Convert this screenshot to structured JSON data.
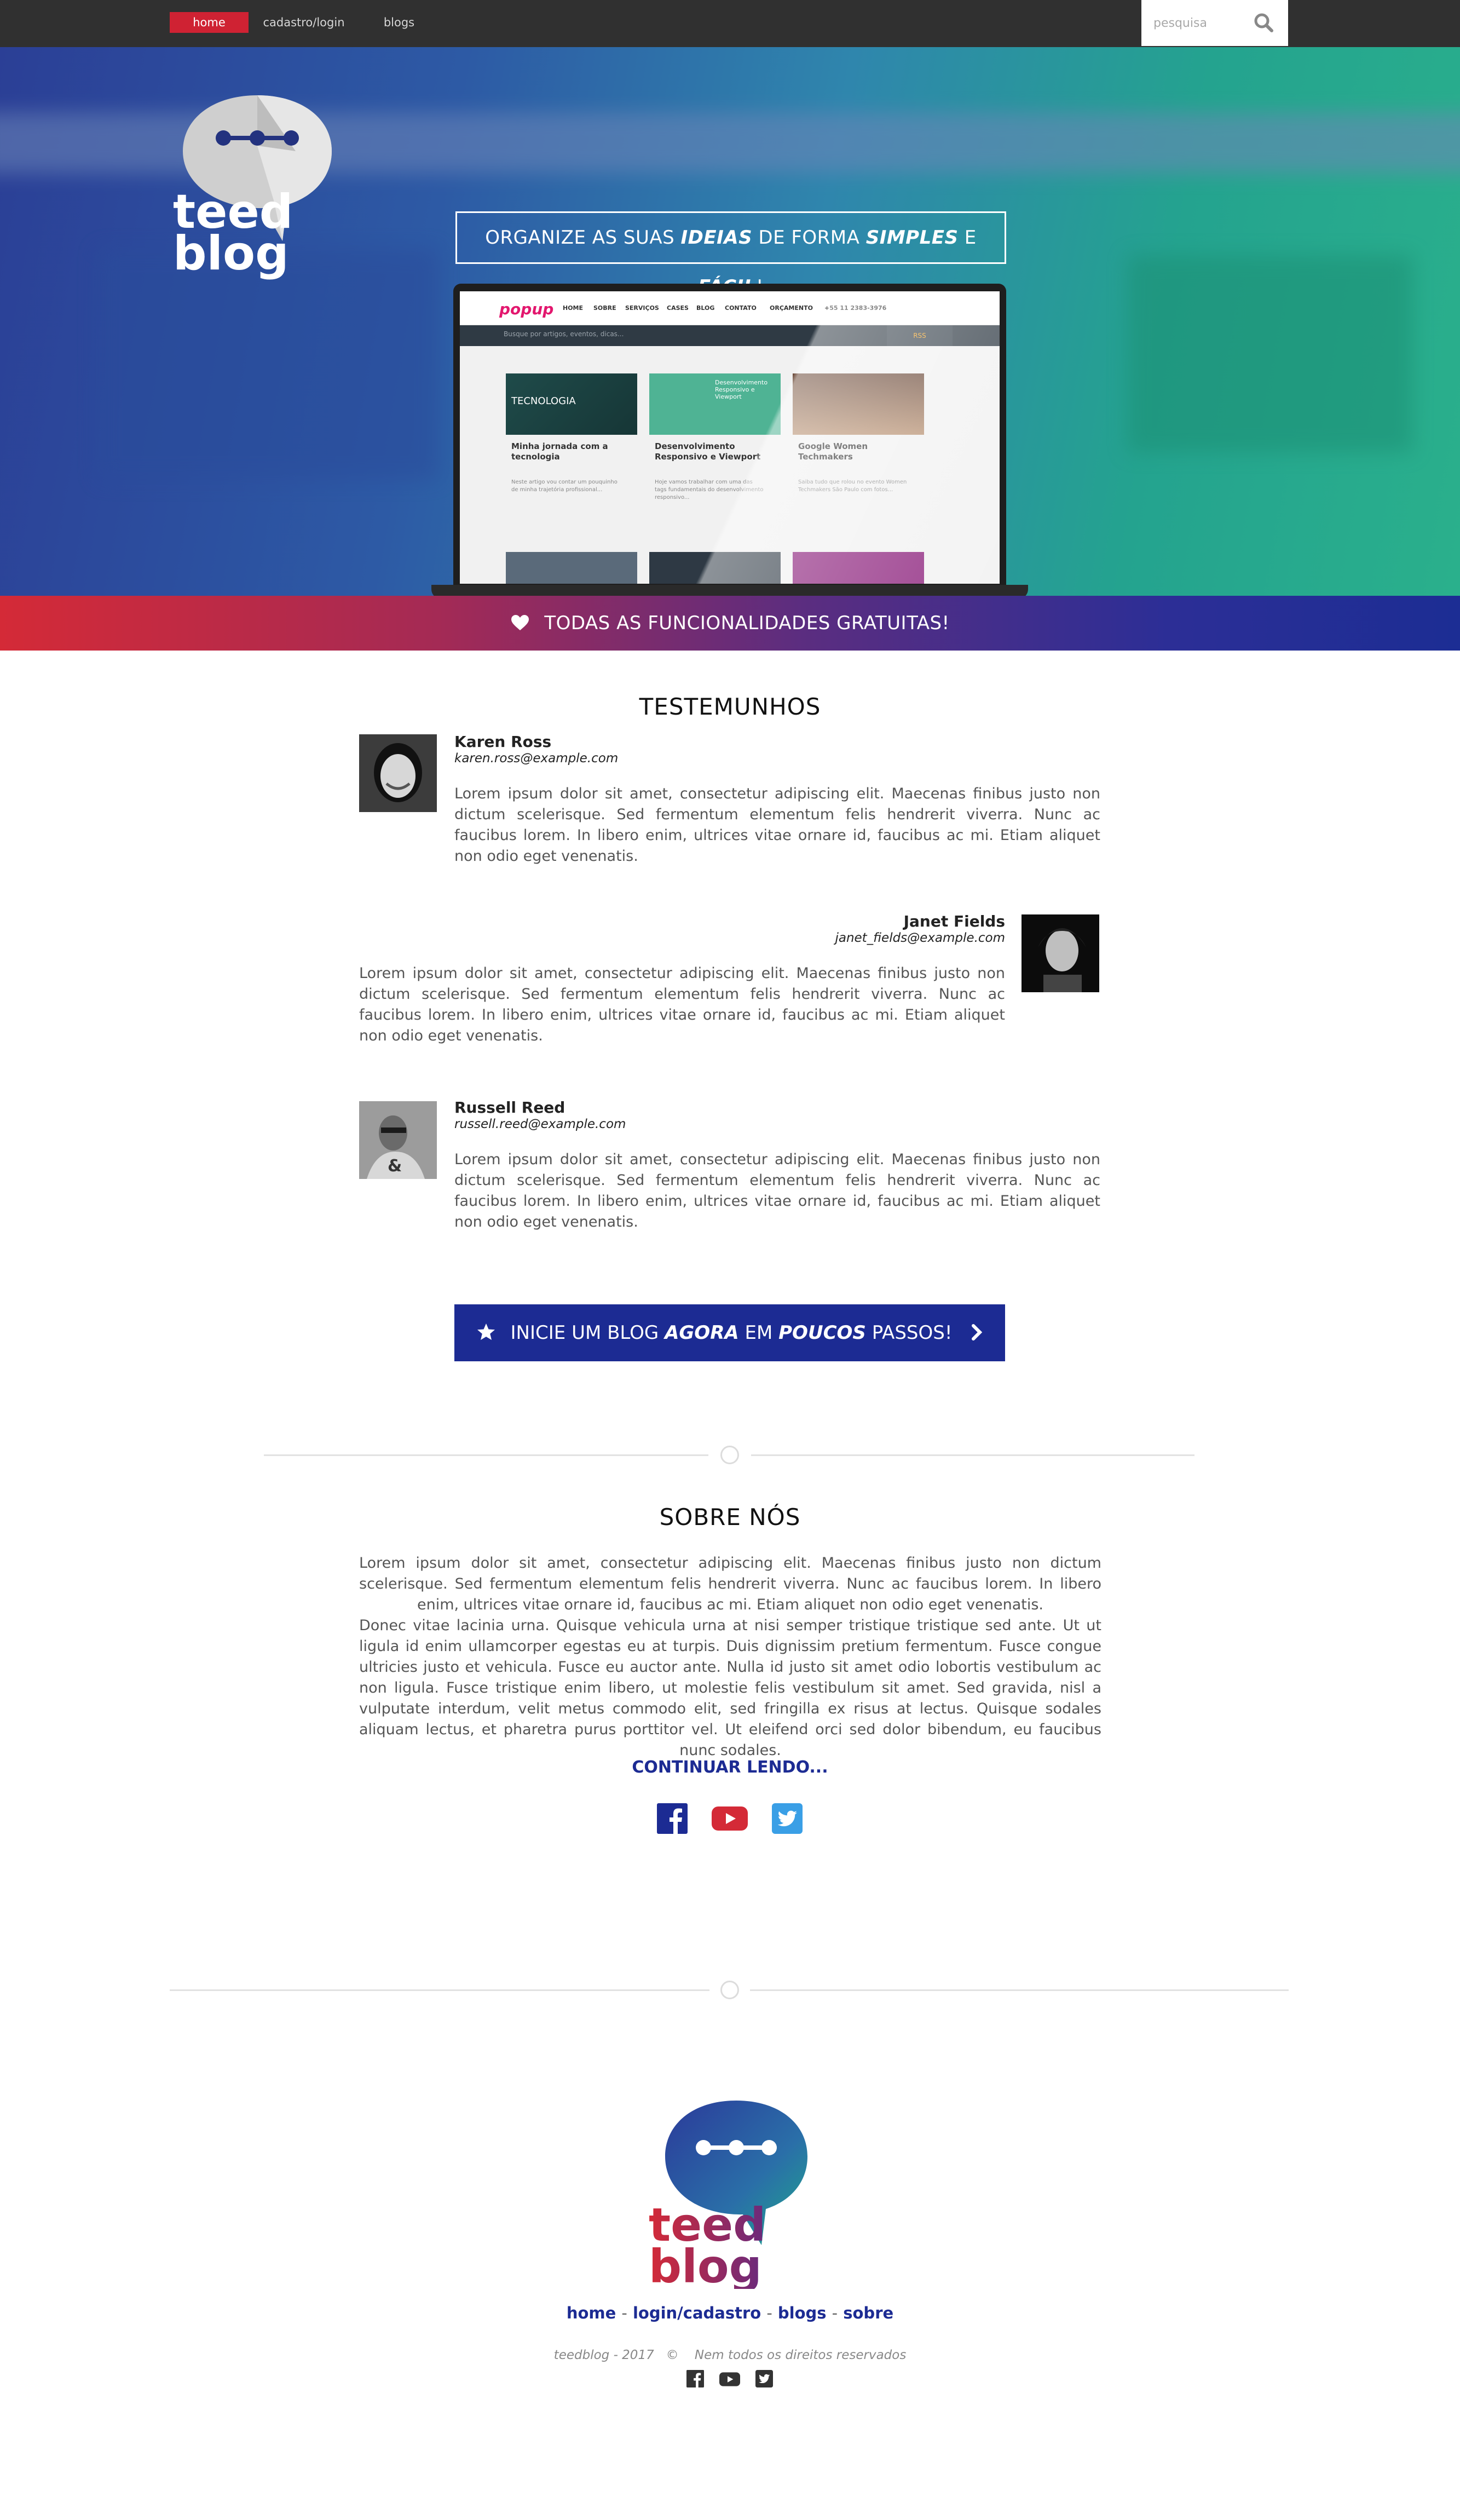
{
  "nav": {
    "items": [
      {
        "label": "home",
        "active": true
      },
      {
        "label": "cadastro/login",
        "active": false
      },
      {
        "label": "blogs",
        "active": false
      }
    ],
    "search_placeholder": "pesquisa"
  },
  "brand": {
    "logo_line1": "teed",
    "logo_line2": "blog"
  },
  "hero": {
    "tagline_1": "ORGANIZE AS SUAS ",
    "tagline_2": "IDEIAS",
    "tagline_3": " DE FORMA ",
    "tagline_4": "SIMPLES",
    "tagline_5": " E ",
    "tagline_6": "FÁCIL",
    "tagline_7": "!",
    "mockup": {
      "logo": "popup",
      "menu": [
        "HOME",
        "SOBRE",
        "SERVIÇOS",
        "CASES",
        "BLOG",
        "CONTATO",
        "ORÇAMENTO",
        "+55 11 2383-3976"
      ],
      "search": "Busque por artigos, eventos, dicas...",
      "rss": "RSS",
      "cards": [
        {
          "img_text": "TECNOLOGIA",
          "title": "Minha jornada com a tecnologia",
          "text": "Neste artigo vou contar um pouquinho de minha trajetória profissional..."
        },
        {
          "img_text": "Desenvolvimento Responsivo e Viewport",
          "title": "Desenvolvimento Responsivo e Viewport",
          "text": "Hoje vamos trabalhar com uma das tags fundamentais do desenvolvimento responsivo..."
        },
        {
          "img_text": "",
          "title": "Google Women Techmakers",
          "text": "Saiba tudo que rolou no evento Women Techmakers São Paulo com fotos..."
        }
      ]
    }
  },
  "free_band": {
    "text": "TODAS AS FUNCIONALIDADES GRATUITAS!"
  },
  "testimonials": {
    "title": "TESTEMUNHOS",
    "items": [
      {
        "name": "Karen Ross",
        "email": "karen.ross@example.com",
        "text": "Lorem ipsum dolor sit amet, consectetur adipiscing elit. Maecenas finibus justo non dictum scelerisque. Sed fermentum elementum felis hendrerit viverra. Nunc ac faucibus lorem. In libero enim, ultrices vitae ornare id, faucibus ac mi. Etiam aliquet non odio eget venenatis."
      },
      {
        "name": "Janet Fields",
        "email": "janet_fields@example.com",
        "text": "Lorem ipsum dolor sit amet, consectetur adipiscing elit. Maecenas finibus justo non dictum scelerisque. Sed fermentum elementum felis hendrerit viverra. Nunc ac faucibus lorem. In libero enim, ultrices vitae ornare id, faucibus ac mi. Etiam aliquet non odio eget venenatis."
      },
      {
        "name": "Russell Reed",
        "email": "russell.reed@example.com",
        "text": "Lorem ipsum dolor sit amet, consectetur adipiscing elit. Maecenas finibus justo non dictum scelerisque. Sed fermentum elementum felis hendrerit viverra. Nunc ac faucibus lorem. In libero enim, ultrices vitae ornare id, faucibus ac mi. Etiam aliquet non odio eget venenatis."
      }
    ]
  },
  "cta": {
    "t1": "INICIE UM BLOG ",
    "t2": "AGORA",
    "t3": " EM ",
    "t4": "POUCOS",
    "t5": " PASSOS!"
  },
  "about": {
    "title": "SOBRE NÓS",
    "p1": "Lorem ipsum dolor sit amet, consectetur adipiscing elit. Maecenas finibus justo non dictum scelerisque. Sed fermentum elementum felis hendrerit viverra. Nunc ac faucibus lorem. In libero enim, ultrices vitae ornare id, faucibus ac mi. Etiam aliquet non odio eget venenatis.",
    "p2": "Donec vitae lacinia urna. Quisque vehicula urna at nisi semper tristique tristique sed ante. Ut ut ligula id enim ullamcorper egestas eu at turpis. Duis dignissim pretium fermentum. Fusce congue ultricies justo et vehicula. Fusce eu auctor ante. Nulla id justo sit amet odio lobortis vestibulum ac non ligula. Fusce tristique enim libero, ut molestie felis vestibulum sit amet. Sed gravida, nisl a vulputate interdum, velit metus commodo elit, sed fringilla ex risus at lectus. Quisque sodales aliquam lectus, et pharetra purus porttitor vel. Ut eleifend orci sed dolor bibendum, eu faucibus nunc sodales.",
    "read_more": "CONTINUAR LENDO..."
  },
  "footer": {
    "links": [
      "home",
      "login/cadastro",
      "blogs",
      "sobre"
    ],
    "separator": "-",
    "copy_left": "teedblog - 2017",
    "copy_symbol": "©",
    "copy_right": "Nem todos os direitos reservados"
  },
  "colors": {
    "accent_red": "#cf2233",
    "brand_blue": "#1c2b93",
    "topbar": "#303030"
  }
}
